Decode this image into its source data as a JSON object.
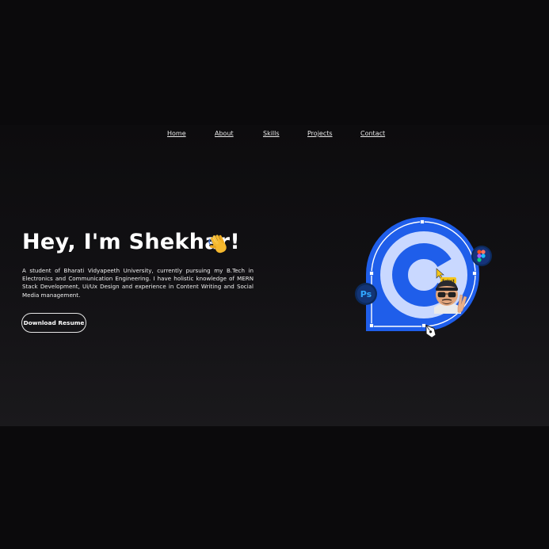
{
  "nav": {
    "items": [
      {
        "label": "Home"
      },
      {
        "label": "About"
      },
      {
        "label": "Skills"
      },
      {
        "label": "Projects"
      },
      {
        "label": "Contact"
      }
    ]
  },
  "hero": {
    "title": "Hey, I'm Shekhar!",
    "description": "A student of Bharati Vidyapeeth University, currently pursuing my B.Tech in Electronics and Communication Engineering. I have holistic knowledge of MERN Stack Development, Ui/Ux Design and experience in Content Writing and Social Media management.",
    "resume_button": "Download Resume"
  },
  "illustration": {
    "select_tag": "Select",
    "ps_badge": "Ps"
  },
  "colors": {
    "background": "#0b0a0c",
    "accent_blue": "#1f5eea",
    "light_blue": "#c9d8ff"
  }
}
